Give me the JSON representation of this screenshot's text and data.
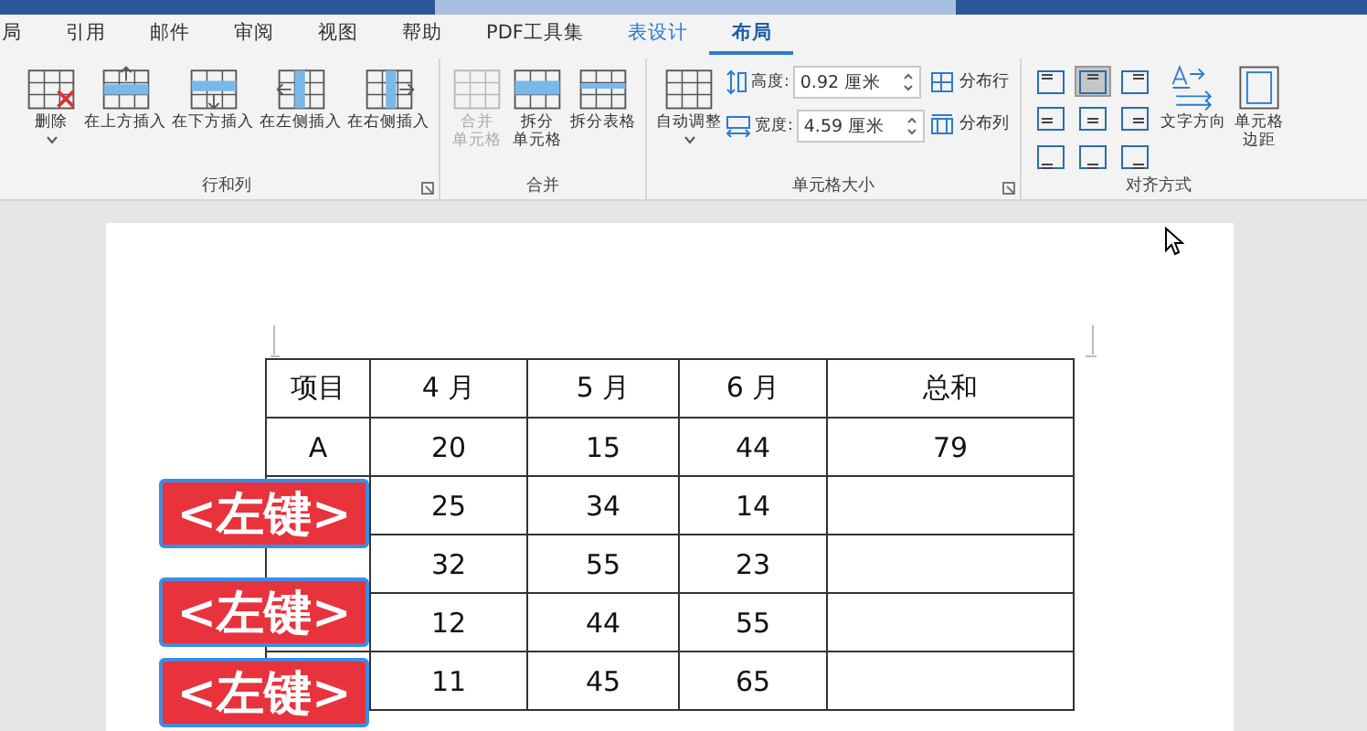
{
  "tabs": [
    {
      "label": "局",
      "kind": "normal",
      "selected": false
    },
    {
      "label": "引用",
      "kind": "normal",
      "selected": false
    },
    {
      "label": "邮件",
      "kind": "normal",
      "selected": false
    },
    {
      "label": "审阅",
      "kind": "normal",
      "selected": false
    },
    {
      "label": "视图",
      "kind": "normal",
      "selected": false
    },
    {
      "label": "帮助",
      "kind": "normal",
      "selected": false
    },
    {
      "label": "PDF工具集",
      "kind": "normal",
      "selected": false
    },
    {
      "label": "表设计",
      "kind": "contextual",
      "selected": false
    },
    {
      "label": "布局",
      "kind": "contextual",
      "selected": true
    }
  ],
  "rows_columns": {
    "delete": "删除",
    "insert_buttons": [
      {
        "label": "在上方插入",
        "kind": "above"
      },
      {
        "label": "在下方插入",
        "kind": "below"
      },
      {
        "label": "在左侧插入",
        "kind": "left"
      },
      {
        "label": "在右侧插入",
        "kind": "right"
      }
    ],
    "label": "行和列"
  },
  "merge": {
    "buttons": [
      {
        "lines": [
          "合并",
          "单元格"
        ],
        "kind": "merge",
        "disabled": true
      },
      {
        "lines": [
          "拆分",
          "单元格"
        ],
        "kind": "split",
        "disabled": false
      },
      {
        "lines": [
          "拆分表格"
        ],
        "kind": "split_table",
        "disabled": false
      }
    ],
    "label": "合并"
  },
  "cell_size": {
    "autofit": "自动调整",
    "height": {
      "label": "高度:",
      "value": "0.92 厘米"
    },
    "width": {
      "label": "宽度:",
      "value": "4.59 厘米"
    },
    "distribute_rows": "分布行",
    "distribute_columns": "分布列",
    "label": "单元格大小"
  },
  "alignment": {
    "cells": [
      {
        "selected": false
      },
      {
        "selected": true
      },
      {
        "selected": false
      },
      {
        "selected": false
      },
      {
        "selected": false
      },
      {
        "selected": false
      },
      {
        "selected": false
      },
      {
        "selected": false
      },
      {
        "selected": false
      }
    ],
    "text_direction": "文字方向",
    "cell_margins": [
      "单元格",
      "边距"
    ],
    "label": "对齐方式"
  },
  "table": {
    "columns": [
      "项目",
      "4 月",
      "5 月",
      "6 月",
      "总和"
    ],
    "rows": [
      {
        "item": "A",
        "values": [
          "20",
          "15",
          "44"
        ],
        "total": "79"
      },
      {
        "values": [
          "25",
          "34",
          "14"
        ]
      },
      {
        "values": [
          "32",
          "55",
          "23"
        ]
      },
      {
        "values": [
          "12",
          "44",
          "55"
        ]
      },
      {
        "values": [
          "11",
          "45",
          "65"
        ]
      }
    ]
  },
  "key_overlays": [
    {
      "label": "<左键>"
    },
    {
      "label": "<左键>"
    },
    {
      "label": "<左键>"
    }
  ]
}
